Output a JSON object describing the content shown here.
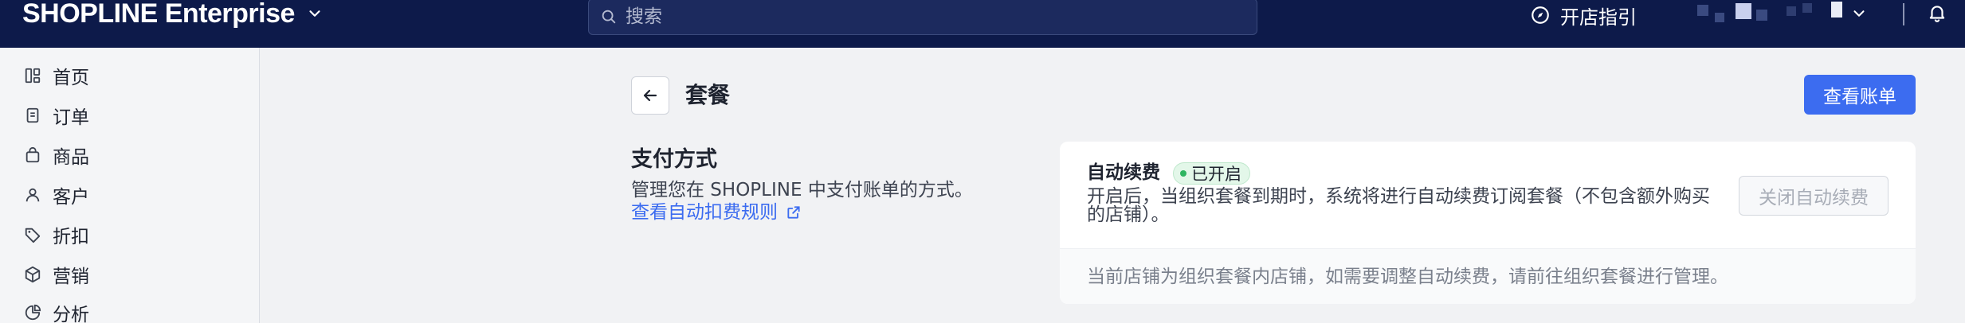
{
  "topbar": {
    "brand": "SHOPLINE Enterprise",
    "search_placeholder": "搜索",
    "guide_label": "开店指引"
  },
  "sidebar": {
    "items": [
      {
        "label": "首页",
        "icon": "dashboard-icon"
      },
      {
        "label": "订单",
        "icon": "order-icon"
      },
      {
        "label": "商品",
        "icon": "bag-icon"
      },
      {
        "label": "客户",
        "icon": "person-icon"
      },
      {
        "label": "折扣",
        "icon": "tag-icon"
      },
      {
        "label": "营销",
        "icon": "cube-icon"
      },
      {
        "label": "分析",
        "icon": "pie-icon"
      }
    ]
  },
  "header": {
    "title": "套餐",
    "view_bill_label": "查看账单"
  },
  "payment": {
    "title": "支付方式",
    "description": "管理您在 SHOPLINE 中支付账单的方式。",
    "link_label": "查看自动扣费规则"
  },
  "auto_renew": {
    "title": "自动续费",
    "status": "已开启",
    "description": "开启后，当组织套餐到期时，系统将进行自动续费订阅套餐（不包含额外购买的店铺）。",
    "disable_label": "关闭自动续费",
    "note": "当前店铺为组织套餐内店铺，如需要调整自动续费，请前往组织套餐进行管理。"
  },
  "colors": {
    "topbar": "#0d1a4a",
    "primary": "#3c6cf0",
    "badge_bg": "#e3f7e9",
    "badge_dot": "#2fb561"
  }
}
